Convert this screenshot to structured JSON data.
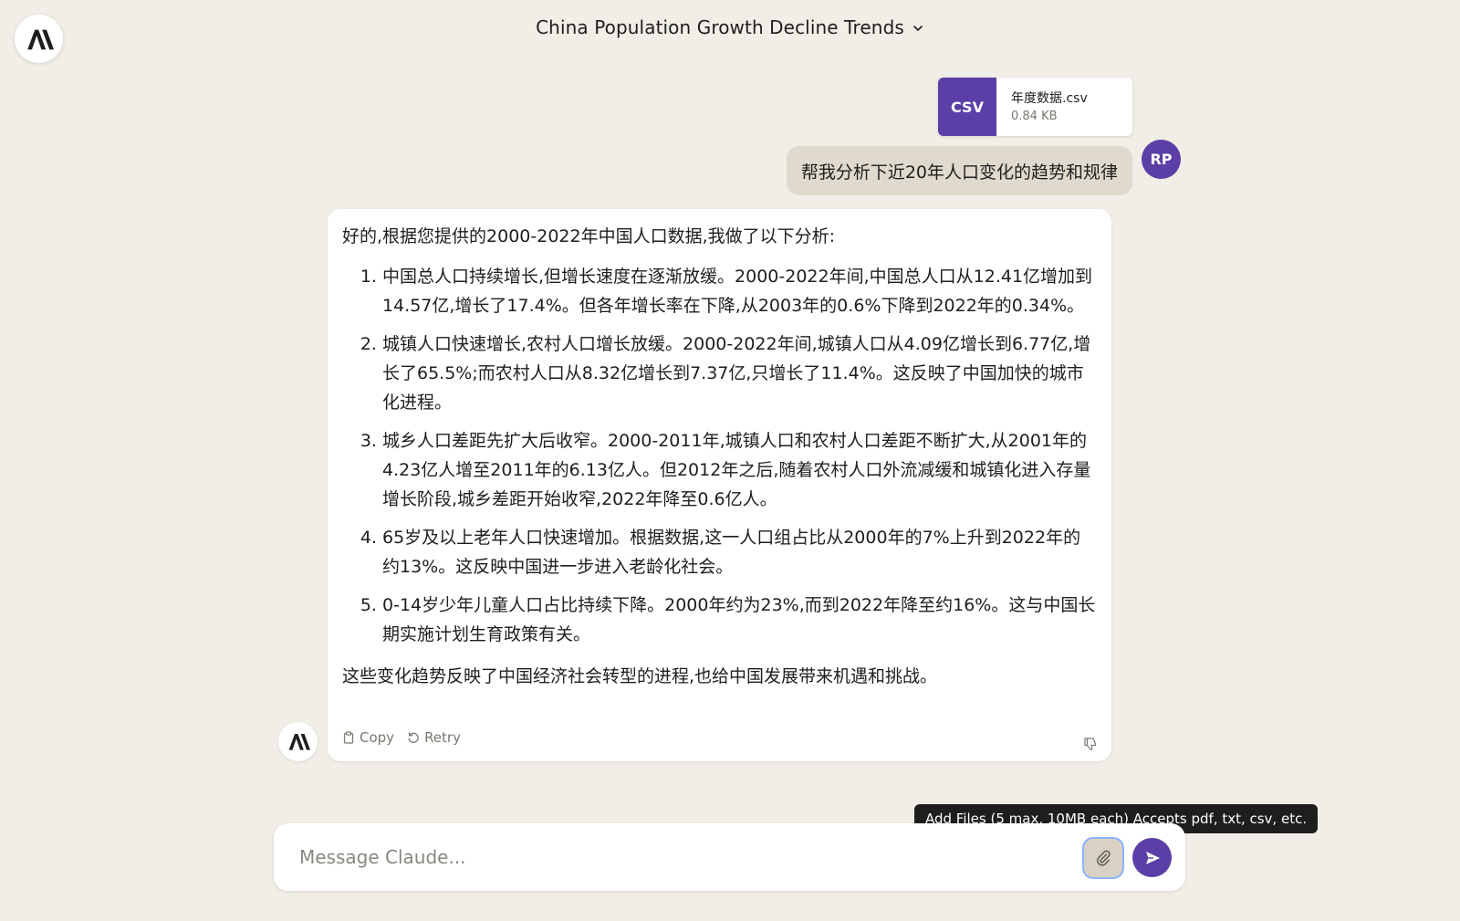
{
  "header": {
    "title": "China Population Growth Decline Trends",
    "logo_icon": "anthropic-logo-icon",
    "title_dropdown_icon": "chevron-down-icon"
  },
  "attachment": {
    "type_label": "CSV",
    "file_name": "年度数据.csv",
    "file_size": "0.84 KB"
  },
  "user_message": {
    "text": "帮我分析下近20年人口变化的趋势和规律",
    "avatar_initials": "RP"
  },
  "assistant_message": {
    "intro": "好的,根据您提供的2000-2022年中国人口数据,我做了以下分析:",
    "points": [
      "中国总人口持续增长,但增长速度在逐渐放缓。2000-2022年间,中国总人口从12.41亿增加到14.57亿,增长了17.4%。但各年增长率在下降,从2003年的0.6%下降到2022年的0.34%。",
      "城镇人口快速增长,农村人口增长放缓。2000-2022年间,城镇人口从4.09亿增长到6.77亿,增长了65.5%;而农村人口从8.32亿增长到7.37亿,只增长了11.4%。这反映了中国加快的城市化进程。",
      "城乡人口差距先扩大后收窄。2000-2011年,城镇人口和农村人口差距不断扩大,从2001年的4.23亿人增至2011年的6.13亿人。但2012年之后,随着农村人口外流减缓和城镇化进入存量增长阶段,城乡差距开始收窄,2022年降至0.6亿人。",
      "65岁及以上老年人口快速增加。根据数据,这一人口组占比从2000年的7%上升到2022年的约13%。这反映中国进一步进入老龄化社会。",
      "0-14岁少年儿童人口占比持续下降。2000年约为23%,而到2022年降至约16%。这与中国长期实施计划生育政策有关。"
    ],
    "outro": "这些变化趋势反映了中国经济社会转型的进程,也给中国发展带来机遇和挑战。",
    "actions": {
      "copy_label": "Copy",
      "retry_label": "Retry"
    }
  },
  "tooltip": {
    "text": "Add Files (5 max, 10MB each) Accepts pdf, txt, csv, etc."
  },
  "composer": {
    "placeholder": "Message Claude...",
    "value": ""
  },
  "colors": {
    "background": "#f0eee6",
    "accent": "#5b3fa6",
    "user_bubble": "#e0d9cd",
    "tooltip_bg": "#1f1e1d"
  }
}
